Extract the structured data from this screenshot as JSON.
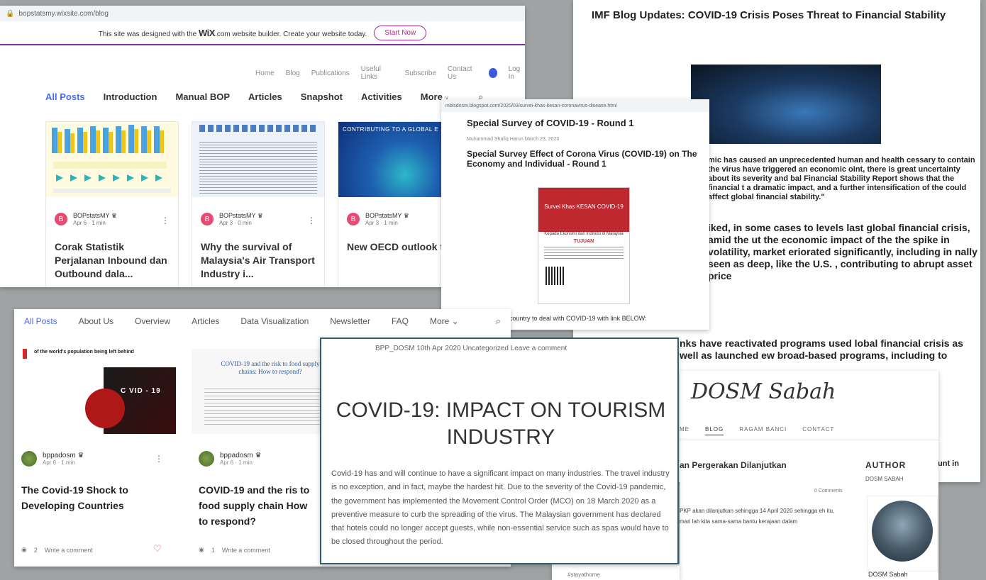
{
  "wix": {
    "url": "bopstatsmy.wixsite.com/blog",
    "banner_pre": "This site was designed with the",
    "banner_brand": "WiX",
    "banner_post": ".com website builder. Create your website today.",
    "start_now": "Start Now",
    "topnav": [
      "Home",
      "Blog",
      "Publications",
      "Useful Links",
      "Subscribe",
      "Contact Us"
    ],
    "login": "Log In",
    "cats": [
      "All Posts",
      "Introduction",
      "Manual BOP",
      "Articles",
      "Snapshot",
      "Activities",
      "More"
    ],
    "cards": [
      {
        "avatar": "B",
        "author": "BOPstatsMY",
        "meta": "Apr 6 · 1 min",
        "title": "Corak Statistik Perjalanan Inbound dan Outbound dala..."
      },
      {
        "avatar": "B",
        "author": "BOPstatsMY",
        "meta": "Apr 3 · 0 min",
        "title": "Why the survival of Malaysia's Air Transport Industry i..."
      },
      {
        "avatar": "B",
        "author": "BOPstatsMY",
        "meta": "Apr 3 · 1 min",
        "title": "New OECD outlook the global econom",
        "thumb_text": "CONTRIBUTING TO A GLOBAL E"
      }
    ]
  },
  "imf": {
    "title": "IMF Blog Updates: COVID-19 Crisis Poses Threat to Financial Stability",
    "para": "mic has caused an unprecedented human and health cessary to contain the virus have triggered an economic oint, there is great uncertainty about its severity and bal Financial Stability Report shows that the financial t a dramatic impact, and a further intensification of the could affect global financial stability.\"",
    "big": "iked, in some cases to levels last global financial crisis, amid the ut the economic impact of the the spike in volatility, market eriorated significantly, including in nally seen as deep, like the U.S. , contributing to abrupt asset price",
    "big2": "nks have reactivated programs used lobal financial crisis as well as launched ew broad-based programs, including to",
    "frag": "unt in"
  },
  "blogspot": {
    "url": "mblsdosm.blogspot.com/2020/03/survei-khas-kesan-coronavirus-disease.html",
    "h1": "Special Survey of COVID-19 - Round 1",
    "meta": "Muhammad Shafiq Harun  March 23, 2020",
    "h2": "Special Survey Effect of Corona Virus (COVID-19) on The Economy and Individual - Round 1",
    "poster_title": "Survei Khas KESAN COVID-19",
    "poster_sub": "Kepada Ekonomi dan Individu di Malaysia",
    "poster_tujuan": "TUJUAN",
    "foot": "country to deal with COVID-19 with link BELOW:"
  },
  "posts": {
    "nav": [
      "All Posts",
      "About Us",
      "Overview",
      "Articles",
      "Data Visualization",
      "Newsletter",
      "FAQ",
      "More"
    ],
    "cards": [
      {
        "img_text": "of the world's population being left behind",
        "book": "C VID - 19",
        "author": "bppadosm",
        "meta": "Apr 6 · 1 min",
        "title": "The Covid-19 Shock to Developing Countries",
        "views": "2",
        "comment": "Write a comment"
      },
      {
        "img_title": "COVID-19 and the risk to food supply chains: How to respond?",
        "author": "bppadosm",
        "meta": "Apr 6 · 1 min",
        "title": "COVID-19 and the ris to food supply chain How to respond?",
        "views": "1",
        "comment": "Write a comment"
      }
    ]
  },
  "tourism": {
    "meta": "BPP_DOSM   10th Apr 2020   Uncategorized   Leave a comment",
    "title": "COVID-19: IMPACT ON TOURISM INDUSTRY",
    "body": "Covid-19 has and will continue to have a significant impact on many industries. The travel industry is no exception, and in fact, maybe the hardest hit. Due to the severity of the Covid-19 pandemic, the government has implemented the Movement Control Order (MCO) on 18 March 2020 as a preventive measure to curb the spreading of the virus. The Malaysian government has declared that hotels could no longer accept guests, while non-essential service such as spas would have to be closed throughout the period."
  },
  "sabah": {
    "brand": "DOSM Sabah",
    "menu": [
      "ME",
      "BLOG",
      "RAGAM BANCI",
      "CONTACT"
    ],
    "post": "an Pergerakan Dilanjutkan",
    "comments": "0 Comments",
    "excerpt": "PKP akan dilanjutkan sehingga 14 April 2020 sehingga eh itu, mari lah kita sama-sama bantu kerajaan dalam",
    "author_h": "AUTHOR",
    "author_sub": "DOSM SABAH",
    "author_name": "DOSM Sabah",
    "tag": "#stayathome"
  }
}
